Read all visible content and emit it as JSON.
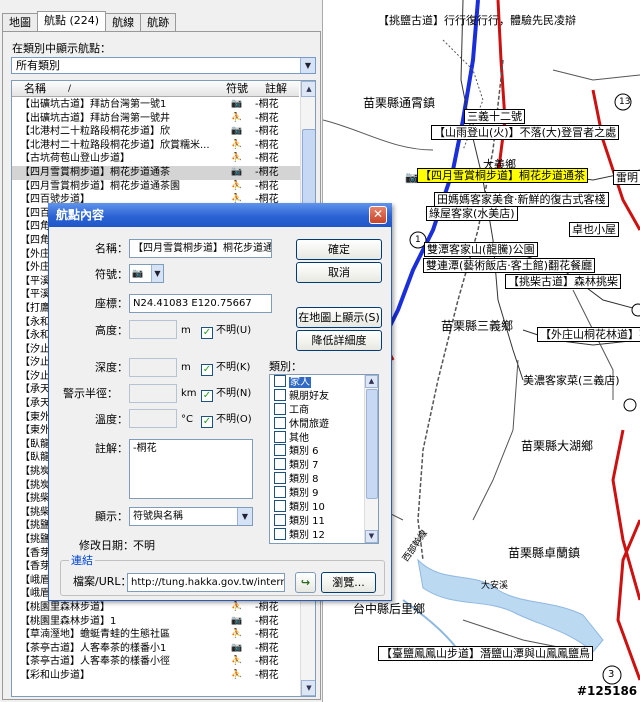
{
  "tabs": [
    "地圖",
    "航點 (224)",
    "航線",
    "航跡"
  ],
  "filter": {
    "label": "在類別中顯示航點：",
    "value": "所有類別"
  },
  "list": {
    "headers": {
      "name": "名稱",
      "symbol": "符號",
      "note": "註解"
    },
    "rows": [
      {
        "name": "【出礦坑古道】拜訪台灣第一號1",
        "symbol": "camera",
        "note": "-桐花"
      },
      {
        "name": "【出礦坑古道】拜訪台灣第一號井",
        "symbol": "hiker",
        "note": "-桐花"
      },
      {
        "name": "【北港村二十粒路段桐花步道】欣",
        "symbol": "camera",
        "note": "-桐花"
      },
      {
        "name": "【北港村二十粒路段桐花步道】欣賞糯米...",
        "symbol": "hiker",
        "note": "-桐花"
      },
      {
        "name": "【古坑荷苞山登山步道】",
        "symbol": "hiker",
        "note": "-桐花"
      },
      {
        "name": "【四月雪賞桐步道】桐花步道通茶",
        "symbol": "camera",
        "note": "-桐花",
        "selected": true
      },
      {
        "name": "【四月雪賞桐步道】桐花步道通茶園",
        "symbol": "hiker",
        "note": "-桐花"
      },
      {
        "name": "【四百號步道】",
        "symbol": "hiker",
        "note": "-桐花"
      },
      {
        "name": "【四百號步道】",
        "symbol": "hiker",
        "note": "-桐花"
      },
      {
        "name": "【四角",
        "symbol": "",
        "note": "-桐花"
      },
      {
        "name": "【四角",
        "symbol": "",
        "note": "-桐花"
      },
      {
        "name": "【外庄",
        "symbol": "",
        "note": "-桐花"
      },
      {
        "name": "【外庄",
        "symbol": "",
        "note": "-桐花"
      },
      {
        "name": "【平溪",
        "symbol": "",
        "note": "-桐花"
      },
      {
        "name": "【平溪",
        "symbol": "",
        "note": "-桐花"
      },
      {
        "name": "【打鷹",
        "symbol": "",
        "note": "-桐花"
      },
      {
        "name": "【永和",
        "symbol": "",
        "note": "-桐花"
      },
      {
        "name": "【永和",
        "symbol": "",
        "note": "-桐花"
      },
      {
        "name": "【汐止",
        "symbol": "",
        "note": "-桐花"
      },
      {
        "name": "【汐止",
        "symbol": "",
        "note": "-桐花"
      },
      {
        "name": "【汐止",
        "symbol": "",
        "note": "-桐花"
      },
      {
        "name": "【承天",
        "symbol": "",
        "note": "-桐花"
      },
      {
        "name": "【承天",
        "symbol": "",
        "note": "-桐花"
      },
      {
        "name": "【東外",
        "symbol": "",
        "note": "-桐花"
      },
      {
        "name": "【東外",
        "symbol": "",
        "note": "-桐花"
      },
      {
        "name": "【臥龍",
        "symbol": "",
        "note": "-桐花"
      },
      {
        "name": "【臥龍",
        "symbol": "",
        "note": "-桐花"
      },
      {
        "name": "【挑炭",
        "symbol": "",
        "note": "-桐花"
      },
      {
        "name": "【挑炭",
        "symbol": "",
        "note": "-桐花"
      },
      {
        "name": "【挑柴",
        "symbol": "",
        "note": "-桐花"
      },
      {
        "name": "【挑柴",
        "symbol": "",
        "note": "-桐花"
      },
      {
        "name": "【挑鹽",
        "symbol": "",
        "note": "-桐花"
      },
      {
        "name": "【挑鹽",
        "symbol": "",
        "note": "-桐花"
      },
      {
        "name": "【香芽",
        "symbol": "",
        "note": "-桐花"
      },
      {
        "name": "【香芽",
        "symbol": "",
        "note": "-桐花"
      },
      {
        "name": "【峨眉",
        "symbol": "",
        "note": "-桐花"
      },
      {
        "name": "【峨眉湖環湖步道】",
        "symbol": "hiker",
        "note": "-桐花"
      },
      {
        "name": "【桃園里森林步道】",
        "symbol": "hiker",
        "note": "-桐花"
      },
      {
        "name": "【桃園里森林步道】1",
        "symbol": "camera",
        "note": "-桐花"
      },
      {
        "name": "【草湳溼地】蟾蜓青蛙的生態社區",
        "symbol": "hiker",
        "note": "-桐花"
      },
      {
        "name": "【茶亭古道】人客奉茶的樣番小1",
        "symbol": "camera",
        "note": "-桐花"
      },
      {
        "name": "【茶亭古道】人客奉茶的樣番小徑",
        "symbol": "hiker",
        "note": "-桐花"
      },
      {
        "name": "【彩和山步道】",
        "symbol": "hiker",
        "note": "-桐花"
      }
    ]
  },
  "map": {
    "labels": [
      {
        "text": "【挑鹽古道】行行復行行，體驗先民凌辯",
        "style": "plain"
      },
      {
        "text": "苗栗縣通霄鎮",
        "style": "plain"
      },
      {
        "text": "三義十二號",
        "style": "box"
      },
      {
        "text": "【山雨登山(火)】不落(大)登冒者之處",
        "style": "box"
      },
      {
        "text": "大義鄉",
        "style": "plain"
      },
      {
        "text": "【四月雪賞桐步道】桐花步道通茶",
        "style": "highlight"
      },
      {
        "text": "雷明",
        "style": "plain"
      },
      {
        "text": "田媽媽客家美食·新鮮的復古式客棧",
        "style": "box"
      },
      {
        "text": "綠屋客家(水美店)",
        "style": "box"
      },
      {
        "text": "卓也小屋",
        "style": "box"
      },
      {
        "text": "雙潭客家山(龍騰)公園",
        "style": "box"
      },
      {
        "text": "雙連潭(藝術飯店·客土館)翻花餐廳",
        "style": "box"
      },
      {
        "text": "【挑柴古道】森林挑柴",
        "style": "box"
      },
      {
        "text": "苗栗縣三義鄉",
        "style": "plain"
      },
      {
        "text": "【外庄山桐花林道】花張",
        "style": "box"
      },
      {
        "text": "苗栗縣大湖鄉",
        "style": "plain"
      },
      {
        "text": "美濃客家菜(三義店)",
        "style": "plain"
      },
      {
        "text": "苗栗縣卓蘭鎮",
        "style": "plain"
      },
      {
        "text": "大安溪",
        "style": "plain"
      },
      {
        "text": "台中縣后里鄉",
        "style": "plain"
      },
      {
        "text": "【臺鹽鳳鳳山步道】潛鹽山潭與山鳳鳳鹽鳥",
        "style": "box"
      },
      {
        "text": "西部幹線",
        "style": "plain"
      }
    ],
    "shields": [
      "13",
      "1",
      "3"
    ],
    "watermark": "#125186"
  },
  "dialog": {
    "title": "航點內容",
    "fields": {
      "name": {
        "label": "名稱：",
        "value": "【四月雪賞桐步道】桐花步道通"
      },
      "symbol": {
        "label": "符號：",
        "icon": "camera-icon"
      },
      "coords": {
        "label": "座標：",
        "value": "N24.41083 E120.75667"
      },
      "altitude": {
        "label": "高度：",
        "unit": "m",
        "unknown": "不明(U)"
      },
      "depth": {
        "label": "深度：",
        "unit": "m",
        "unknown": "不明(K)"
      },
      "proximity": {
        "label": "警示半徑：",
        "unit": "km",
        "unknown": "不明(N)"
      },
      "temperature": {
        "label": "溫度：",
        "unit": "°C",
        "unknown": "不明(O)"
      },
      "comment": {
        "label": "註解：",
        "value": "-桐花"
      },
      "display": {
        "label": "顯示：",
        "value": "符號與名稱"
      },
      "modified": {
        "label": "修改日期：",
        "value": "不明"
      }
    },
    "buttons": {
      "ok": "確定",
      "cancel": "取消",
      "show_on_map": "在地圖上顯示(S)",
      "reduce_detail": "降低詳細度",
      "browse": "瀏覽..."
    },
    "categories": {
      "label": "類別：",
      "items": [
        "家人",
        "親朋好友",
        "工商",
        "休閒旅遊",
        "其他",
        "類別 6",
        "類別 7",
        "類別 8",
        "類別 9",
        "類別 10",
        "類別 11",
        "類別 12"
      ]
    },
    "link": {
      "legend": "連結",
      "label": "檔案/URL：",
      "value": "http://tung.hakka.gov.tw/internet/sce"
    }
  }
}
